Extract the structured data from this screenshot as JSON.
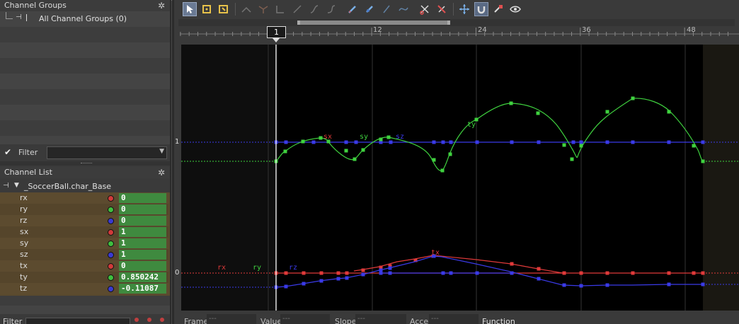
{
  "channel_groups": {
    "title": "Channel Groups",
    "item_label": "All Channel Groups (0)"
  },
  "filter": {
    "label": "Filter",
    "placeholder": ""
  },
  "channel_list": {
    "title": "Channel List",
    "node_label": "_SoccerBall.char_Base",
    "channels": [
      {
        "name": "rx",
        "value": "0",
        "color": "#d23a3a"
      },
      {
        "name": "ry",
        "value": "0",
        "color": "#3fbf3f"
      },
      {
        "name": "rz",
        "value": "0",
        "color": "#3a3ad2"
      },
      {
        "name": "sx",
        "value": "1",
        "color": "#d23a3a"
      },
      {
        "name": "sy",
        "value": "1",
        "color": "#3fbf3f"
      },
      {
        "name": "sz",
        "value": "1",
        "color": "#3a3ad2"
      },
      {
        "name": "tx",
        "value": "0",
        "color": "#d23a3a"
      },
      {
        "name": "ty",
        "value": "0.850242",
        "color": "#3fbf3f"
      },
      {
        "name": "tz",
        "value": "-0.11087",
        "color": "#3a3ad2"
      }
    ]
  },
  "bottom_filter": {
    "label": "Filter"
  },
  "timeline": {
    "current_frame": "1",
    "ticks": [
      "12",
      "24",
      "36",
      "48"
    ]
  },
  "graph": {
    "y_labels": [
      "1",
      "0"
    ],
    "curve_labels": {
      "sx": "sx",
      "sy": "sy",
      "sz": "sz",
      "ty": "ty",
      "rx": "rx",
      "ry": "ry",
      "rz": "rz",
      "tx": "tx"
    }
  },
  "status_bar": {
    "frame_label": "Frame",
    "frame_value": "---",
    "value_label": "Value",
    "value_value": "---",
    "slope_label": "Slope",
    "slope_value": "---",
    "accel_label": "Accel",
    "accel_value": "---",
    "function_label": "Function"
  },
  "colors": {
    "red": "#e03a3a",
    "green": "#3fd23f",
    "blue": "#3a3ae8",
    "graph_bg": "#000000",
    "value_field": "#3f8a3f"
  }
}
